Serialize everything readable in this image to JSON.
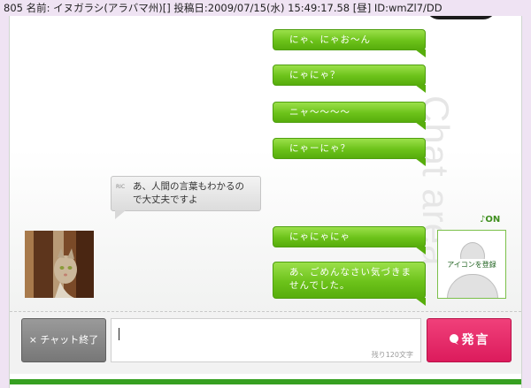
{
  "post_header": "805 名前: イヌガラシ(アラバマ州)[] 投稿日:2009/07/15(水) 15:49:17.58 [昼] ID:wmZl7/DD",
  "chat": {
    "watermark": "Chat area",
    "outgoing": [
      "にゃ、にゃお～ん",
      "にゃにゃ？",
      "ニャ～～～～",
      "にゃーにゃ？",
      "にゃにゃにゃ",
      "あ、ごめんなさい気づきませんでした。"
    ],
    "incoming": {
      "tag": "RIC",
      "text": "あ、人間の言葉もわかるので大丈夫ですよ"
    },
    "status_toggle": "♪ON",
    "avatar_label": "アイコンを登録"
  },
  "input_bar": {
    "end_button": "× チャット終了",
    "message_value": "",
    "remaining": "残り120文字",
    "speak_button": "発言"
  },
  "colors": {
    "bubble_green": "#6cc21a",
    "speak_pink": "#e5286a",
    "accent_green": "#36a021"
  }
}
